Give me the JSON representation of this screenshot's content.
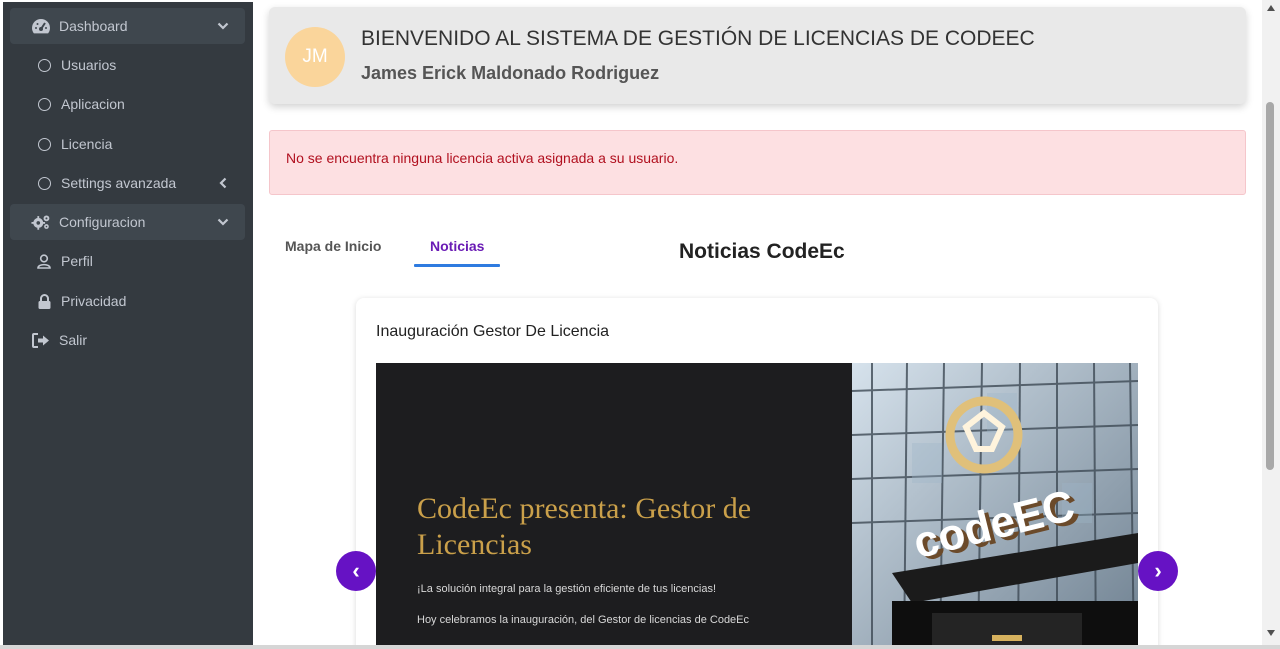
{
  "sidebar": {
    "items": [
      {
        "label": "Dashboard",
        "icon": "tachometer-icon",
        "state": "open"
      },
      {
        "label": "Usuarios",
        "icon": "circle-icon"
      },
      {
        "label": "Aplicacion",
        "icon": "circle-icon"
      },
      {
        "label": "Licencia",
        "icon": "circle-icon"
      },
      {
        "label": "Settings avanzada",
        "icon": "circle-icon",
        "state": "collapsed"
      },
      {
        "label": "Configuracion",
        "icon": "cogs-icon",
        "state": "open"
      },
      {
        "label": "Perfil",
        "icon": "user-icon"
      },
      {
        "label": "Privacidad",
        "icon": "lock-icon"
      },
      {
        "label": "Salir",
        "icon": "sign-out-icon"
      }
    ]
  },
  "header": {
    "avatar_initials": "JM",
    "welcome": "BIENVENIDO AL SISTEMA DE GESTIÓN DE LICENCIAS DE CODEEC",
    "username": "James Erick Maldonado Rodriguez"
  },
  "alert": {
    "message": "No se encuentra ninguna licencia activa asignada a su usuario."
  },
  "tabs": [
    {
      "label": "Mapa de Inicio",
      "active": false
    },
    {
      "label": "Noticias",
      "active": true
    }
  ],
  "news": {
    "section_title": "Noticias CodeEc",
    "card_title": "Inauguración Gestor De Licencia",
    "slide": {
      "heading": "CodeEc presenta: Gestor de Licencias",
      "line1": "¡La solución integral para la gestión eficiente de tus licencias!",
      "line2": "Hoy celebramos la inauguración, del Gestor de licencias de CodeEc",
      "sign_text": "codeEC"
    },
    "prev_icon": "‹",
    "next_icon": "›"
  },
  "colors": {
    "sidebar_bg": "#343a40",
    "accent_purple": "#6612c4",
    "tab_underline": "#2e7be0",
    "alert_bg": "#fde0e2",
    "alert_text": "#b1101f",
    "avatar_bg": "#fad59b",
    "slide_gold": "#caa04a"
  }
}
